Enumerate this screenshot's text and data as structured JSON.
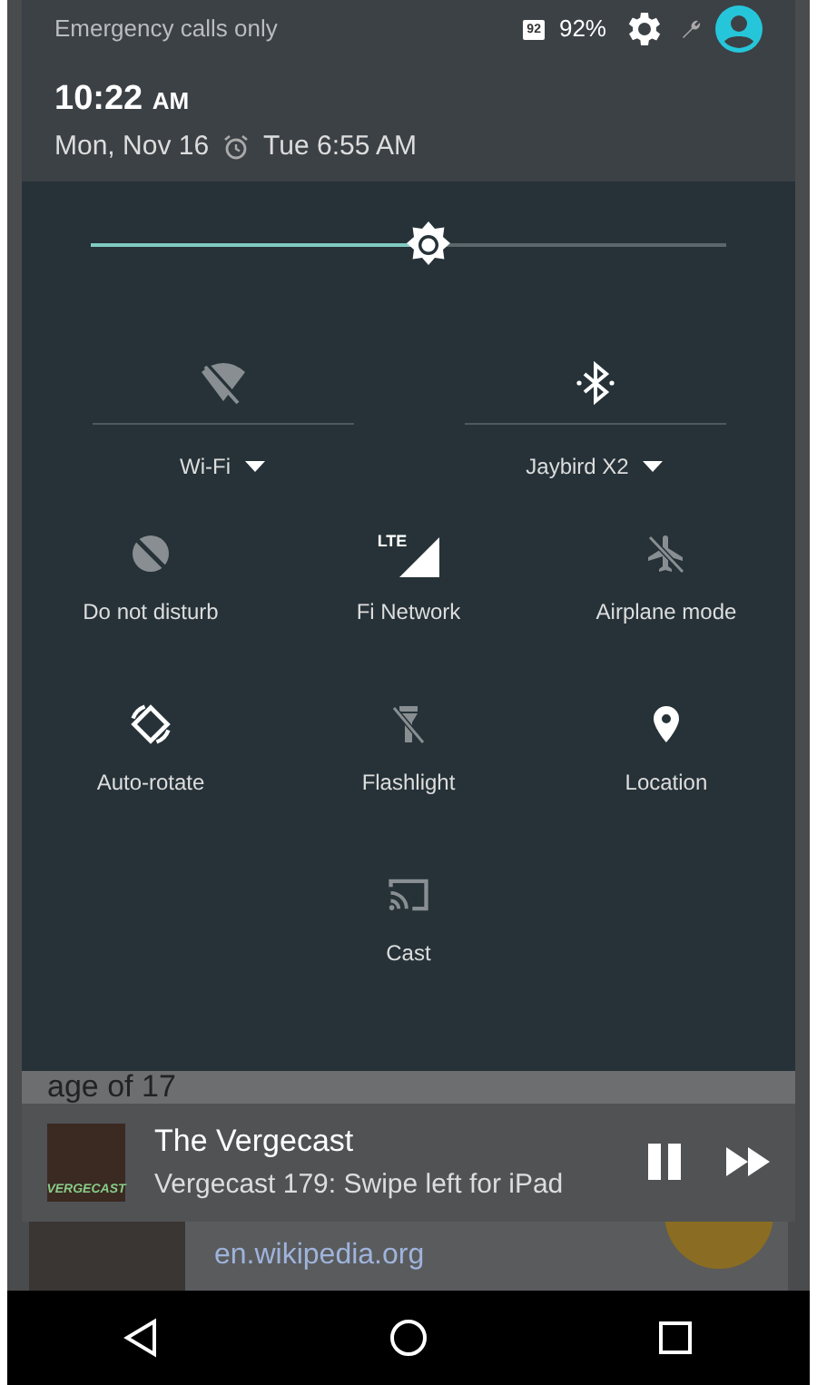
{
  "status_bar": {
    "carrier": "Emergency calls only",
    "battery_badge": "92",
    "battery": "92%"
  },
  "header": {
    "time": "10:22",
    "ampm": "AM",
    "date": "Mon, Nov 16",
    "alarm": "Tue 6:55 AM"
  },
  "brightness": {
    "level": 0.53
  },
  "wide_tiles": [
    {
      "kind": "wifi",
      "label": "Wi-Fi",
      "on": false
    },
    {
      "kind": "bluetooth",
      "label": "Jaybird X2",
      "on": true
    }
  ],
  "tiles": [
    {
      "kind": "dnd",
      "label": "Do not disturb",
      "on": false
    },
    {
      "kind": "lte",
      "label": "Fi Network",
      "on": true,
      "badge": "LTE"
    },
    {
      "kind": "airplane",
      "label": "Airplane mode",
      "on": false
    },
    {
      "kind": "rotate",
      "label": "Auto-rotate",
      "on": true
    },
    {
      "kind": "flashlight",
      "label": "Flashlight",
      "on": false
    },
    {
      "kind": "location",
      "label": "Location",
      "on": true
    },
    {
      "kind": "cast",
      "label": "Cast",
      "on": false
    }
  ],
  "background_text": "age of 17",
  "media": {
    "art_text": "VERGECAST",
    "title": "The Vergecast",
    "subtitle": "Vergecast 179: Swipe left for iPad",
    "playing": true
  },
  "search_result": {
    "site": "en.wikipedia.org"
  }
}
